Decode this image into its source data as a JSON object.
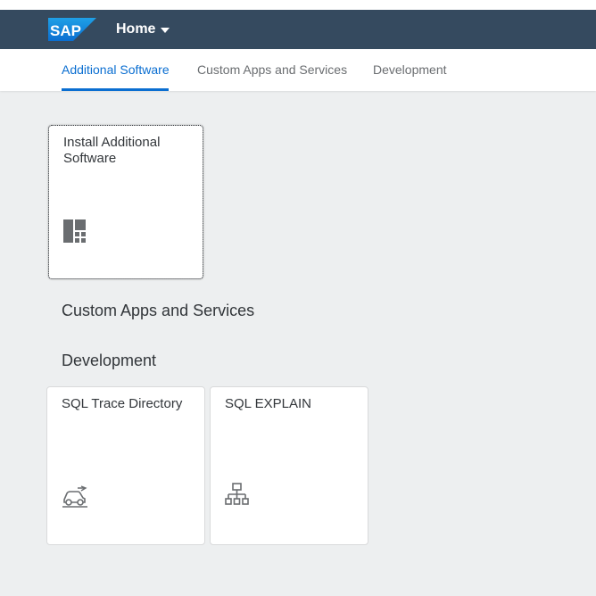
{
  "shell": {
    "logo_text": "SAP",
    "home_label": "Home"
  },
  "tabs": [
    {
      "label": "Additional Software",
      "active": true
    },
    {
      "label": "Custom Apps and Services",
      "active": false
    },
    {
      "label": "Development",
      "active": false
    }
  ],
  "groups": {
    "additional_software": {
      "tiles": [
        {
          "title": "Install Additional Software",
          "icon": "dashboard-icon"
        }
      ]
    },
    "custom_apps": {
      "title": "Custom Apps and Services"
    },
    "development": {
      "title": "Development",
      "tiles": [
        {
          "title": "SQL Trace Directory",
          "icon": "car-trace-icon"
        },
        {
          "title": "SQL EXPLAIN",
          "icon": "hierarchy-icon"
        }
      ]
    }
  },
  "colors": {
    "shell_bg": "#354a5f",
    "accent": "#0a6ed1",
    "page_bg": "#edeff0"
  }
}
